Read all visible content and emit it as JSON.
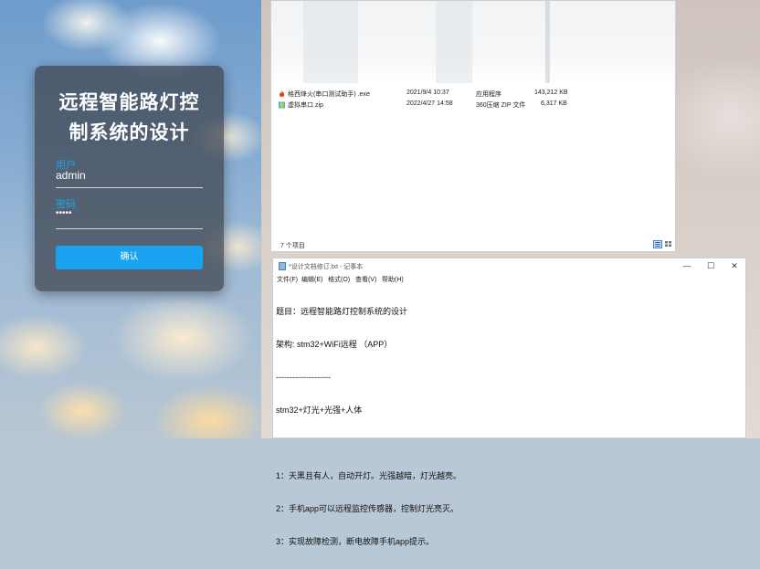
{
  "login": {
    "title_line1": "远程智能路灯控",
    "title_line2": "制系统的设计",
    "username_label": "用户",
    "username_value": "admin",
    "password_label": "密码",
    "password_value": "•••••",
    "confirm_label": "确认"
  },
  "explorer": {
    "files": [
      {
        "name": "格西烽火(串口测试助手) .exe",
        "date": "2021/9/4 10:37",
        "type": "应用程序",
        "size": "143,212 KB",
        "icon": "exe-flame-icon"
      },
      {
        "name": "虚拟串口.zip",
        "date": "2022/4/27 14:58",
        "type": "360压缩 ZIP 文件",
        "size": "6,317 KB",
        "icon": "zip-archive-icon"
      }
    ],
    "status": "7 个项目",
    "colors": {
      "accent": "#1aa3f0"
    }
  },
  "notepad": {
    "title": "*设计文档修订.txt - 记事本",
    "controls": {
      "minimize": "—",
      "maximize": "☐",
      "close": "✕"
    },
    "menu": [
      "文件(F)",
      "编辑(E)",
      "格式(O)",
      "查看(V)",
      "帮助(H)"
    ],
    "lines": [
      "题目：远程智能路灯控制系统的设计",
      "架构: stm32+WiFi远程 （APP）",
      "--------------------",
      "stm32+灯光+光强+人体",
      "",
      "1：天黑且有人，自动开灯。光强越暗，灯光越亮。",
      "2：手机app可以远程监控传感器，控制灯光亮灭。",
      "3：实现故障检测，断电故障手机app提示。"
    ]
  }
}
